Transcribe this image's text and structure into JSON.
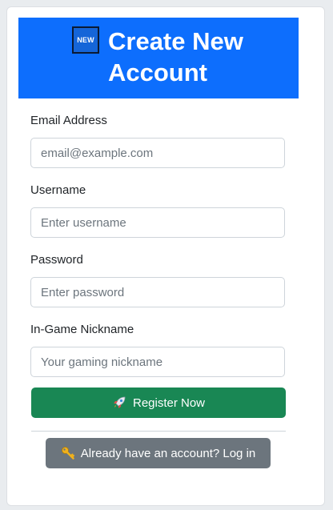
{
  "header": {
    "badge_text": "NEW",
    "title": "Create New Account",
    "background": "#0d6efd"
  },
  "form": {
    "fields": [
      {
        "label": "Email Address",
        "placeholder": "email@example.com",
        "value": ""
      },
      {
        "label": "Username",
        "placeholder": "Enter username",
        "value": ""
      },
      {
        "label": "Password",
        "placeholder": "Enter password",
        "value": ""
      },
      {
        "label": "In-Game Nickname",
        "placeholder": "Your gaming nickname",
        "value": ""
      }
    ]
  },
  "register_button": {
    "label": "Register Now",
    "icon": "rocket-icon",
    "color": "#198754"
  },
  "login_button": {
    "label": "Already have an account? Log in",
    "icon": "key-icon",
    "color": "#6c757d"
  }
}
